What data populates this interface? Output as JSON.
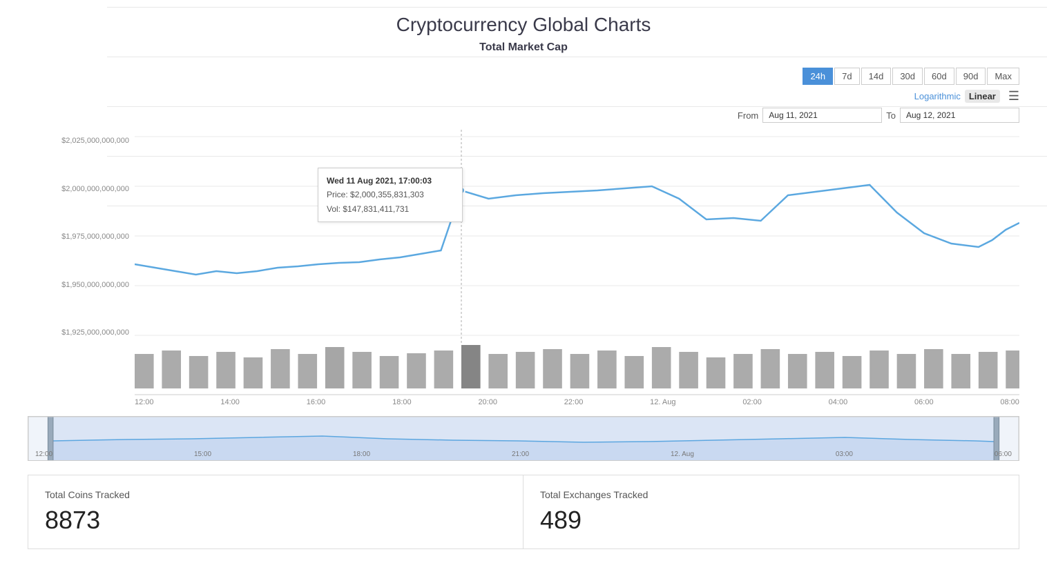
{
  "page": {
    "title": "Cryptocurrency Global Charts",
    "subtitle": "Total Market Cap"
  },
  "controls": {
    "time_buttons": [
      {
        "label": "24h",
        "active": true
      },
      {
        "label": "7d",
        "active": false
      },
      {
        "label": "14d",
        "active": false
      },
      {
        "label": "30d",
        "active": false
      },
      {
        "label": "60d",
        "active": false
      },
      {
        "label": "90d",
        "active": false
      },
      {
        "label": "Max",
        "active": false
      }
    ],
    "scale": {
      "logarithmic": "Logarithmic",
      "linear": "Linear",
      "active": "Linear"
    },
    "from_label": "From",
    "to_label": "To",
    "from_date": "Aug 11, 2021",
    "to_date": "Aug 12, 2021"
  },
  "y_axis": {
    "labels": [
      "$2,025,000,000,000",
      "$2,000,000,000,000",
      "$1,975,000,000,000",
      "$1,950,000,000,000",
      "$1,925,000,000,000"
    ]
  },
  "tooltip": {
    "date": "Wed 11 Aug 2021, 17:00:03",
    "price_label": "Price:",
    "price_value": "$2,000,355,831,303",
    "vol_label": "Vol:",
    "vol_value": "$147,831,411,731"
  },
  "time_labels": [
    "12:00",
    "14:00",
    "16:00",
    "18:00",
    "20:00",
    "22:00",
    "12. Aug",
    "02:00",
    "04:00",
    "06:00",
    "08:00"
  ],
  "nav_time_labels": [
    "12:00",
    "15:00",
    "18:00",
    "21:00",
    "12. Aug",
    "03:00",
    "06:00"
  ],
  "stats": [
    {
      "label": "Total Coins Tracked",
      "value": "8873"
    },
    {
      "label": "Total Exchanges Tracked",
      "value": "489"
    }
  ]
}
